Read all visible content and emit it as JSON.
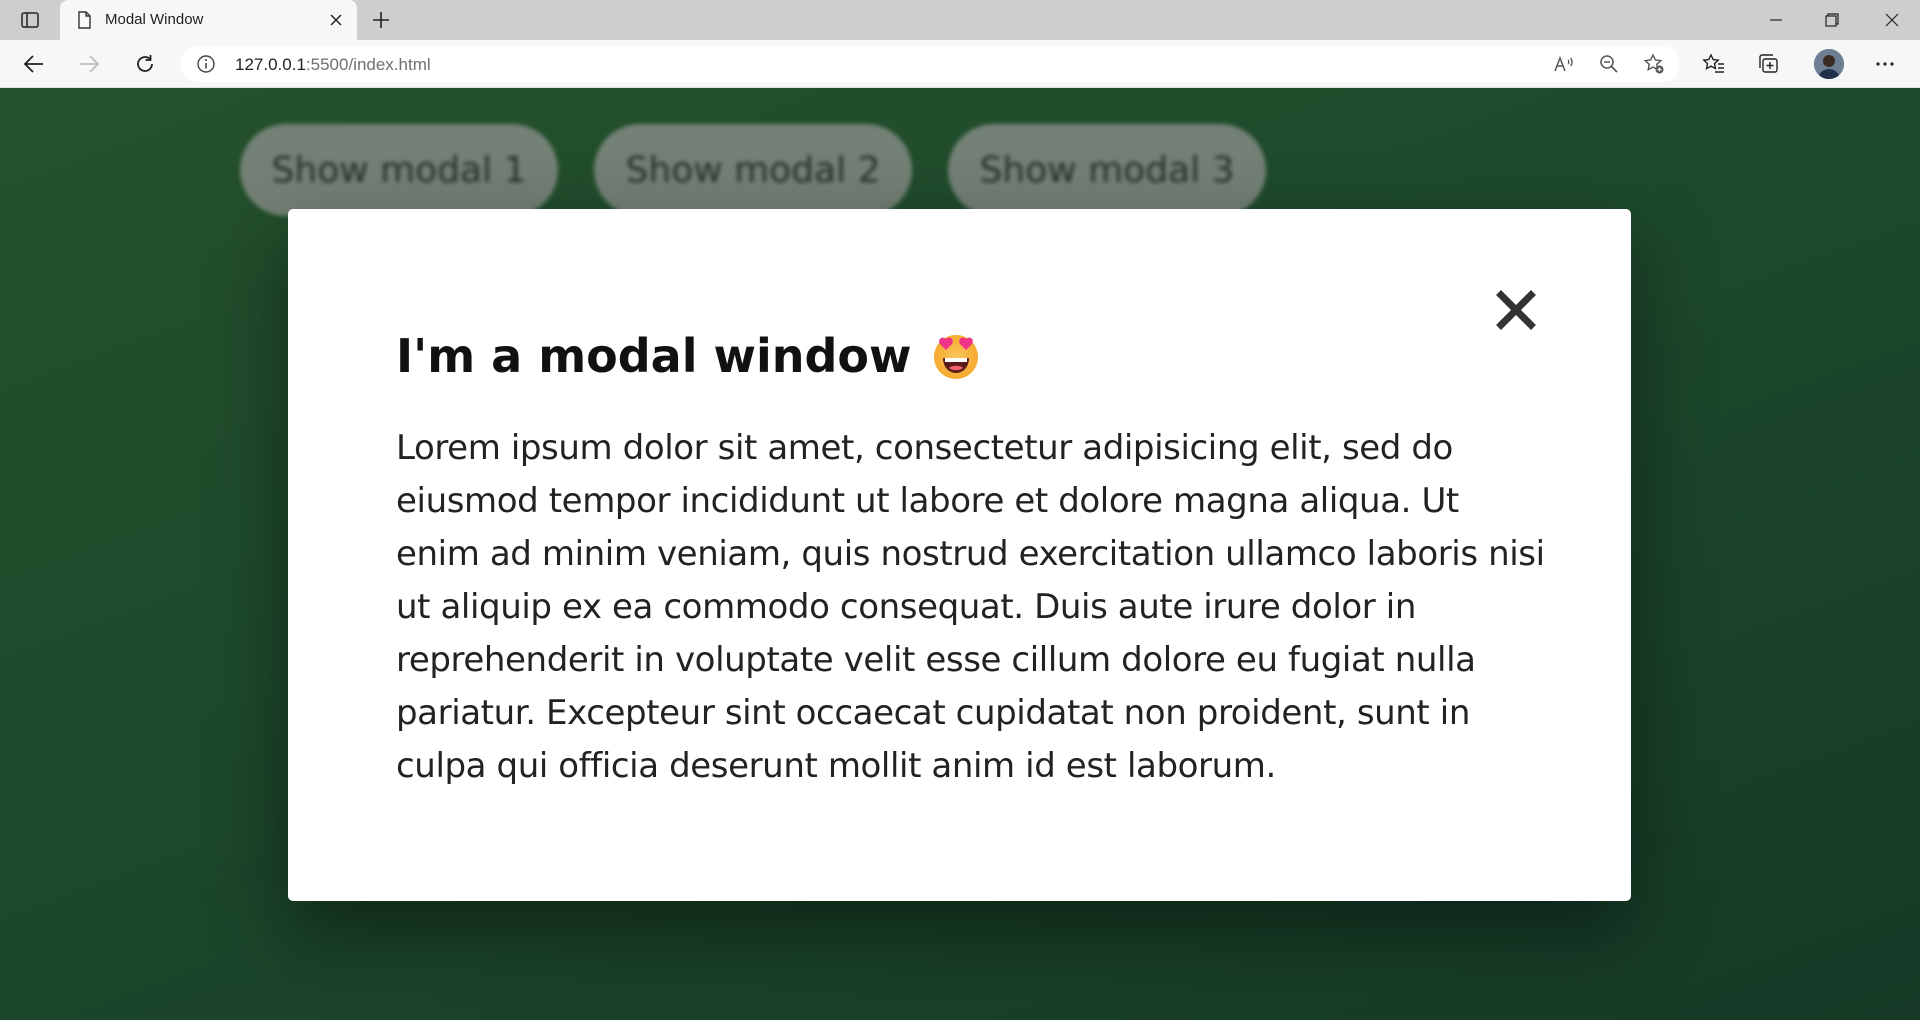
{
  "browser": {
    "tab": {
      "title": "Modal Window"
    },
    "address": {
      "host": "127.0.0.1",
      "path": ":5500/index.html"
    }
  },
  "page": {
    "buttons": [
      "Show modal 1",
      "Show modal 2",
      "Show modal 3"
    ],
    "modal": {
      "title": "I'm a modal window",
      "emoji": "star-struck-heart-eyes-emoji",
      "body": "Lorem ipsum dolor sit amet, consectetur adipisicing elit, sed do eiusmod tempor incididunt ut labore et dolore magna aliqua. Ut enim ad minim veniam, quis nostrud exercitation ullamco laboris nisi ut aliquip ex ea commodo consequat. Duis aute irure dolor in reprehenderit in voluptate velit esse cillum dolore eu fugiat nulla pariatur. Excepteur sint occaecat cupidatat non proident, sunt in culpa qui officia deserunt mollit anim id est laborum."
    }
  },
  "colors": {
    "background_start": "#2e6436",
    "background_end": "#17412f",
    "modal_bg": "#ffffff",
    "button_bg": "#a8aea8"
  }
}
